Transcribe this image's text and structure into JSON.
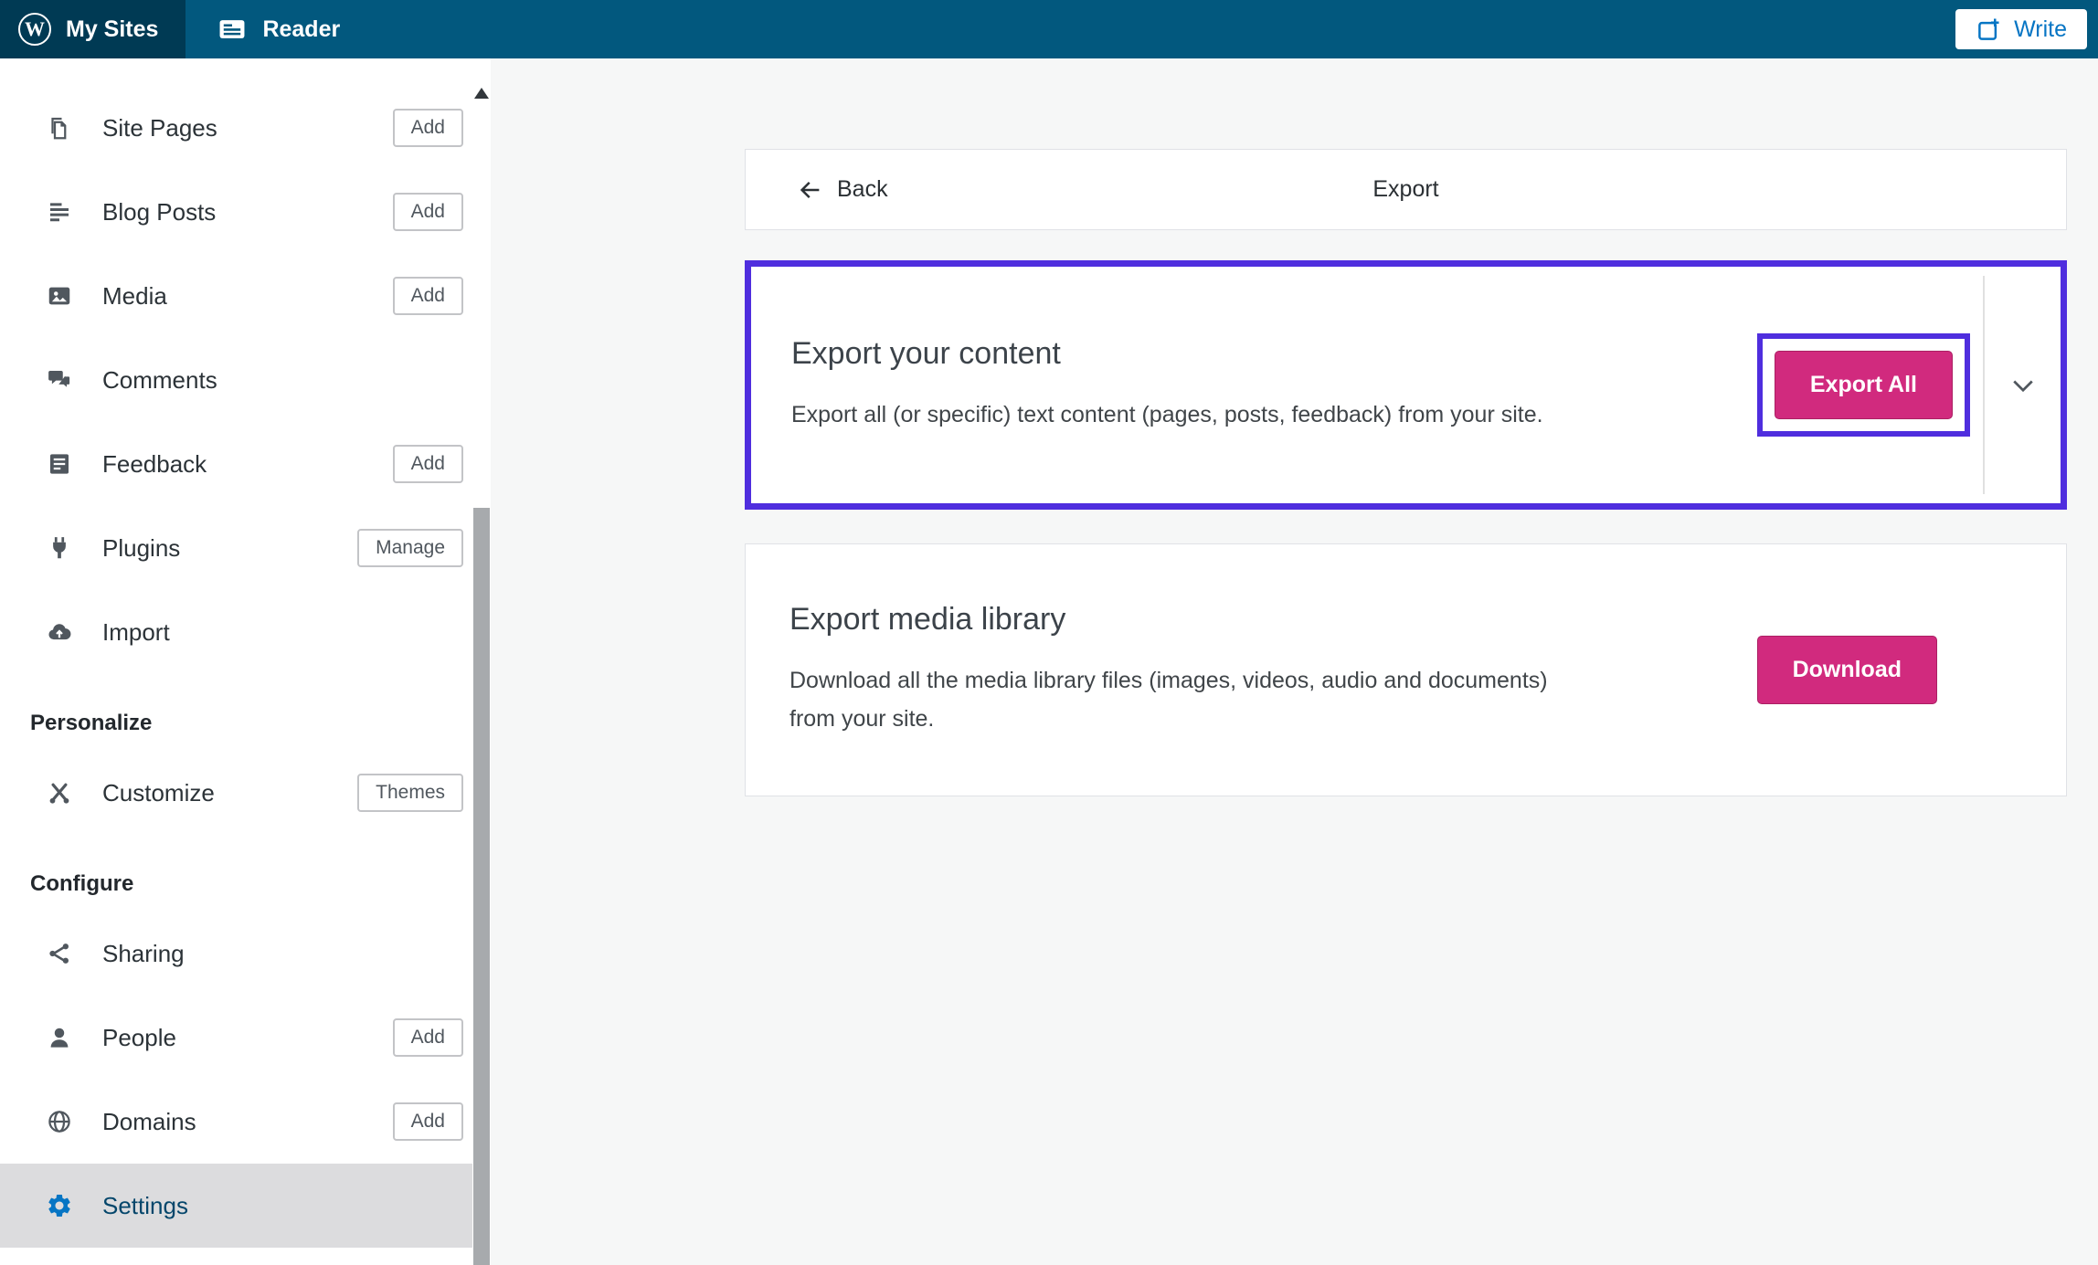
{
  "masthead": {
    "my_sites": "My Sites",
    "reader": "Reader",
    "write": "Write"
  },
  "sidebar": {
    "sections": {
      "personalize": "Personalize",
      "configure": "Configure"
    },
    "items": [
      {
        "label": "Site Pages",
        "action": "Add"
      },
      {
        "label": "Blog Posts",
        "action": "Add"
      },
      {
        "label": "Media",
        "action": "Add"
      },
      {
        "label": "Comments",
        "action": ""
      },
      {
        "label": "Feedback",
        "action": "Add"
      },
      {
        "label": "Plugins",
        "action": "Manage"
      },
      {
        "label": "Import",
        "action": ""
      },
      {
        "label": "Customize",
        "action": "Themes"
      },
      {
        "label": "Sharing",
        "action": ""
      },
      {
        "label": "People",
        "action": "Add"
      },
      {
        "label": "Domains",
        "action": "Add"
      },
      {
        "label": "Settings",
        "action": "",
        "selected": "true"
      }
    ]
  },
  "main": {
    "back": "Back",
    "title": "Export",
    "export_content": {
      "heading": "Export your content",
      "description": "Export all (or specific) text content (pages, posts, feedback) from your site.",
      "button": "Export All"
    },
    "export_media": {
      "heading": "Export media library",
      "description": "Download all the media library files (images, videos, audio and documents) from your site.",
      "button": "Download"
    }
  },
  "colors": {
    "masthead_bg": "#02587e",
    "masthead_selected_bg": "#003a54",
    "primary_button_pink": "#d12a7e",
    "annotation_purple": "#4f2ede",
    "selected_item_bg": "#dcdcde",
    "link_blue": "#0675c4"
  }
}
